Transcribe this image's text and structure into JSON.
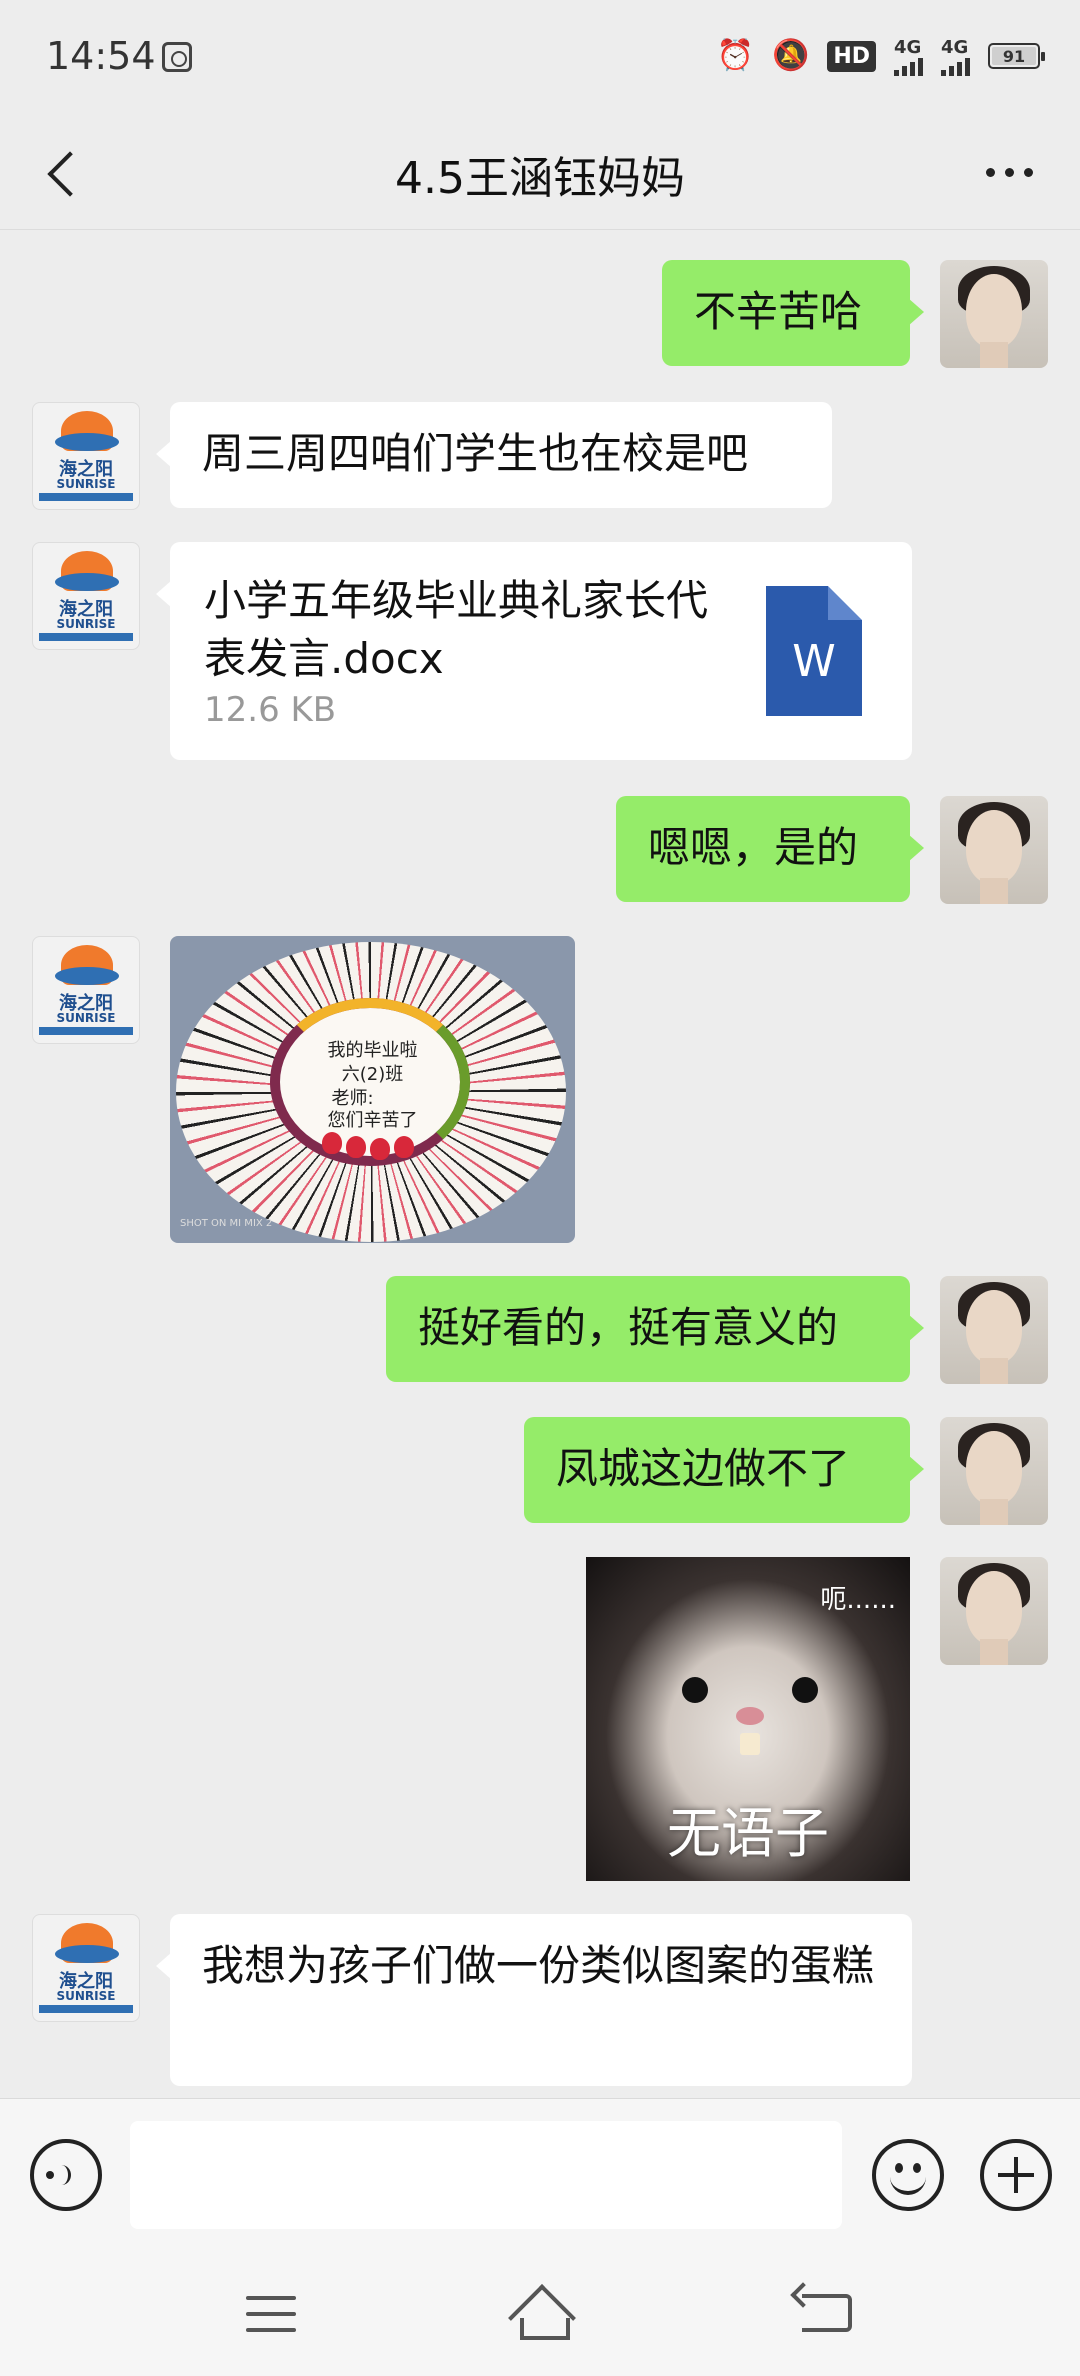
{
  "status_bar": {
    "time": "14:54",
    "hd_label": "HD",
    "network_1": "4G",
    "network_2": "4G",
    "battery": "91"
  },
  "header": {
    "title": "4.5王涵钰妈妈"
  },
  "messages": [
    {
      "side": "right",
      "type": "text",
      "text": "不辛苦哈"
    },
    {
      "side": "left",
      "type": "text",
      "text": "周三周四咱们学生也在校是吧"
    },
    {
      "side": "left",
      "type": "file",
      "file_name": "小学五年级毕业典礼家长代表发言.docx",
      "file_size": "12.6 KB",
      "file_icon": "W"
    },
    {
      "side": "right",
      "type": "text",
      "text": "嗯嗯，是的"
    },
    {
      "side": "left",
      "type": "image",
      "caption_lines": [
        "我的毕业啦",
        "六(2)班",
        "老师:",
        "您们辛苦了"
      ],
      "watermark": "SHOT ON MI MIX 2"
    },
    {
      "side": "right",
      "type": "text",
      "text": "挺好看的，挺有意义的"
    },
    {
      "side": "right",
      "type": "text",
      "text": "凤城这边做不了"
    },
    {
      "side": "right",
      "type": "sticker",
      "top_text": "呃......",
      "bottom_text": "无语子"
    },
    {
      "side": "left",
      "type": "text",
      "text": "我想为孩子们做一份类似图案的蛋糕"
    }
  ],
  "avatars": {
    "left_logo_text": "海之阳",
    "left_logo_sub": "SUNRISE"
  },
  "input_bar": {
    "placeholder": "",
    "voice_icon": "voice-icon",
    "emoji_icon": "emoji-icon",
    "plus_icon": "plus-icon"
  },
  "colors": {
    "background": "#ededed",
    "bubble_self": "#95ec69",
    "bubble_other": "#ffffff"
  }
}
